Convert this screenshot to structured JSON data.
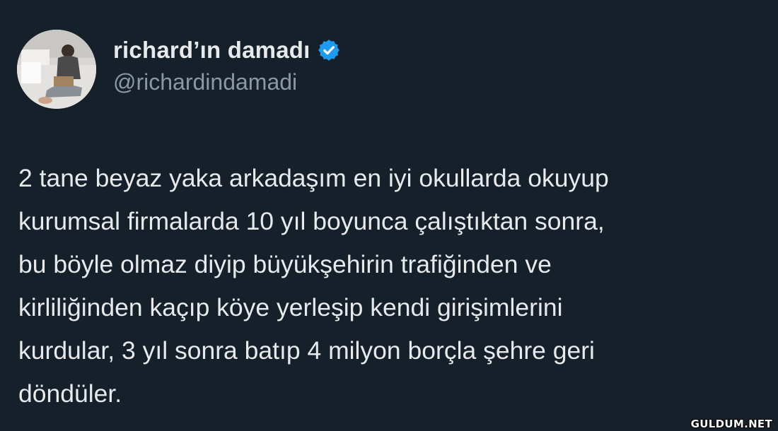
{
  "author": {
    "display_name": "richard’ın damadı",
    "handle": "@richardindamadi",
    "verified": true,
    "verified_color": "#1d9bf0",
    "avatar_icon": "profile-photo"
  },
  "tweet": {
    "lines": [
      "2 tane beyaz yaka arkadaşım en iyi okullarda okuyup",
      "kurumsal firmalarda 10 yıl boyunca çalıştıktan sonra,",
      "bu böyle olmaz diyip büyükşehirin trafiğinden ve",
      "kirliliğinden kaçıp köye yerleşip kendi girişimlerini",
      "kurdular, 3 yıl sonra batıp 4 milyon borçla şehre geri",
      "döndüler."
    ]
  },
  "watermark": "GULDUM.NET",
  "colors": {
    "background": "#15202b",
    "text": "#e7e9ea",
    "handle": "#8b98a5"
  }
}
